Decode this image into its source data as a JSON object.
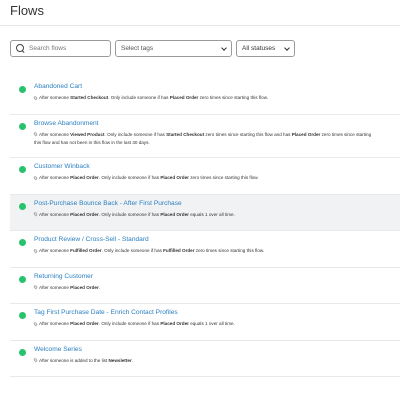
{
  "header": {
    "title": "Flows"
  },
  "filters": {
    "search_placeholder": "Search flows",
    "tags_placeholder": "Select tags",
    "status_value": "All statuses"
  },
  "colors": {
    "active_dot": "#27c26c",
    "link": "#2a7fbf"
  },
  "flows": [
    {
      "name": "Abandoned Cart",
      "t1": "After someone ",
      "b1": "Started Checkout",
      "t2": ". Only include someone if has ",
      "b2": "Placed Order",
      "t3": " zero times since starting this flow.",
      "b3": "",
      "t4": "",
      "b4": "",
      "t5": ""
    },
    {
      "name": "Browse Abandonment",
      "t1": "After someone ",
      "b1": "Viewed Product",
      "t2": ". Only include someone if has ",
      "b2": "Started Checkout",
      "t3": " zero times since starting this flow and has ",
      "b3": "Placed Order",
      "t4": " zero times since starting this flow and has not been in this flow in the last 30 days.",
      "b4": "",
      "t5": ""
    },
    {
      "name": "Customer Winback",
      "t1": "After someone ",
      "b1": "Placed Order",
      "t2": ". Only include someone if has ",
      "b2": "Placed Order",
      "t3": " zero times since starting this flow.",
      "b3": "",
      "t4": "",
      "b4": "",
      "t5": ""
    },
    {
      "name": "Post-Purchase Bounce Back - After First Purchase",
      "t1": "After someone ",
      "b1": "Placed Order",
      "t2": ". Only include someone if has ",
      "b2": "Placed Order",
      "t3": " equals 1 over all time.",
      "b3": "",
      "t4": "",
      "b4": "",
      "t5": ""
    },
    {
      "name": "Product Review / Cross-Sell - Standard",
      "t1": "After someone ",
      "b1": "Fulfilled Order",
      "t2": ". Only include someone if has ",
      "b2": "Fulfilled Order",
      "t3": " zero times since starting this flow.",
      "b3": "",
      "t4": "",
      "b4": "",
      "t5": ""
    },
    {
      "name": "Returning Customer",
      "t1": "After someone ",
      "b1": "Placed Order",
      "t2": ".",
      "b2": "",
      "t3": "",
      "b3": "",
      "t4": "",
      "b4": "",
      "t5": ""
    },
    {
      "name": "Tag First Purchase Date - Enrich Contact Profiles",
      "t1": "After someone ",
      "b1": "Placed Order",
      "t2": ". Only include someone if has ",
      "b2": "Placed Order",
      "t3": " equals 1 over all time.",
      "b3": "",
      "t4": "",
      "b4": "",
      "t5": ""
    },
    {
      "name": "Welcome Series",
      "t1": "After someone is added to the list ",
      "b1": "Newsletter",
      "t2": ".",
      "b2": "",
      "t3": "",
      "b3": "",
      "t4": "",
      "b4": "",
      "t5": ""
    }
  ]
}
